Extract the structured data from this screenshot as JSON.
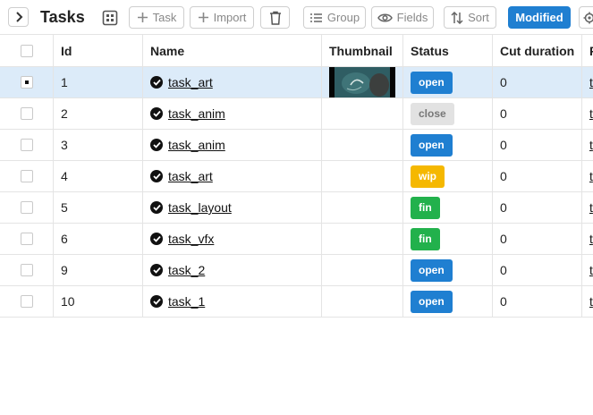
{
  "toolbar": {
    "title": "Tasks",
    "add_task_label": "Task",
    "import_label": "Import",
    "group_label": "Group",
    "fields_label": "Fields",
    "sort_label": "Sort",
    "modified_label": "Modified"
  },
  "columns": {
    "id": "Id",
    "name": "Name",
    "thumbnail": "Thumbnail",
    "status": "Status",
    "cut_duration": "Cut duration",
    "extra": "F"
  },
  "status_colors": {
    "open": "#1f7fd1",
    "close": "#e2e2e2",
    "wip": "#f5b800",
    "fin": "#22b14c"
  },
  "rows": [
    {
      "id": "1",
      "name": "task_art",
      "status": "open",
      "cut": "0",
      "extra": "t",
      "selected": true,
      "thumb": true
    },
    {
      "id": "2",
      "name": "task_anim",
      "status": "close",
      "cut": "0",
      "extra": "t",
      "selected": false,
      "thumb": false
    },
    {
      "id": "3",
      "name": "task_anim",
      "status": "open",
      "cut": "0",
      "extra": "t",
      "selected": false,
      "thumb": false
    },
    {
      "id": "4",
      "name": "task_art",
      "status": "wip",
      "cut": "0",
      "extra": "t",
      "selected": false,
      "thumb": false
    },
    {
      "id": "5",
      "name": "task_layout",
      "status": "fin",
      "cut": "0",
      "extra": "t",
      "selected": false,
      "thumb": false
    },
    {
      "id": "6",
      "name": "task_vfx",
      "status": "fin",
      "cut": "0",
      "extra": "t",
      "selected": false,
      "thumb": false
    },
    {
      "id": "9",
      "name": "task_2",
      "status": "open",
      "cut": "0",
      "extra": "t",
      "selected": false,
      "thumb": false
    },
    {
      "id": "10",
      "name": "task_1",
      "status": "open",
      "cut": "0",
      "extra": "t",
      "selected": false,
      "thumb": false
    }
  ]
}
